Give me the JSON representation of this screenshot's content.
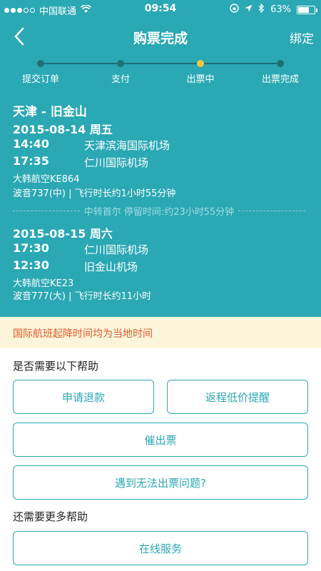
{
  "status": {
    "carrier": "中国联通",
    "time": "09:54",
    "battery": "63%",
    "battery_level": 0.63
  },
  "nav": {
    "title": "购票完成",
    "bind_label": "绑定"
  },
  "steps": [
    {
      "label": "提交订单",
      "active": false
    },
    {
      "label": "支付",
      "active": false
    },
    {
      "label": "出票中",
      "active": true
    },
    {
      "label": "出票完成",
      "active": false
    }
  ],
  "trip": {
    "route": "天津 - 旧金山",
    "leg1": {
      "date": "2015-08-14 周五",
      "dep_time": "14:40",
      "dep_airport": "天津滨海国际机场",
      "arr_time": "17:35",
      "arr_airport": "仁川国际机场",
      "airline": "大韩航空KE864",
      "aircraft": "波音737(中) | 飞行时长约1小时55分钟"
    },
    "transfer": "中转首尔  停留时间:约23小时55分钟",
    "leg2": {
      "date": "2015-08-15 周六",
      "dep_time": "17:30",
      "dep_airport": "仁川国际机场",
      "arr_time": "12:30",
      "arr_airport": "旧金山机场",
      "airline": "大韩航空KE23",
      "aircraft": "波音777(大) | 飞行时长约11小时"
    }
  },
  "notice": "国际航班起降时间均为当地时间",
  "help": {
    "title": "是否需要以下帮助",
    "refund": "申请退款",
    "return_alert": "返程低价提醒",
    "urge": "催出票",
    "issue": "遇到无法出票问题?",
    "more_title": "还需要更多帮助",
    "online_service": "在线服务"
  },
  "colors": {
    "primary": "#2aa8b4",
    "notice_bg": "#fbf5dc",
    "notice_text": "#e25a2a",
    "step_active": "#f5c842"
  }
}
